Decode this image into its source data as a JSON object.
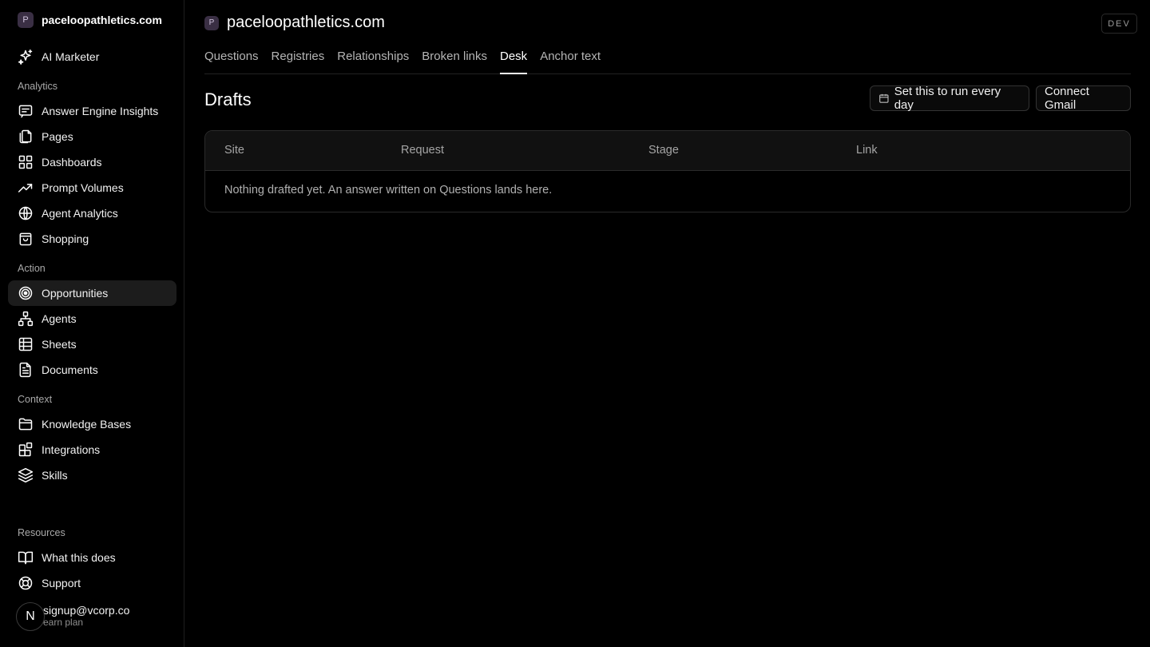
{
  "sidebar": {
    "workspace": {
      "initial": "P",
      "name": "paceloopathletics.com"
    },
    "top_item": {
      "label": "AI Marketer",
      "icon": "sparkles-icon"
    },
    "sections": [
      {
        "title": "Analytics",
        "items": [
          {
            "label": "Answer Engine Insights",
            "icon": "message-square-icon"
          },
          {
            "label": "Pages",
            "icon": "files-icon"
          },
          {
            "label": "Dashboards",
            "icon": "layout-grid-icon"
          },
          {
            "label": "Prompt Volumes",
            "icon": "trending-up-icon"
          },
          {
            "label": "Agent Analytics",
            "icon": "globe-icon"
          },
          {
            "label": "Shopping",
            "icon": "shopping-bag-icon"
          }
        ]
      },
      {
        "title": "Action",
        "items": [
          {
            "label": "Opportunities",
            "icon": "target-icon",
            "active": true
          },
          {
            "label": "Agents",
            "icon": "network-icon"
          },
          {
            "label": "Sheets",
            "icon": "table-icon"
          },
          {
            "label": "Documents",
            "icon": "file-text-icon"
          }
        ]
      },
      {
        "title": "Context",
        "items": [
          {
            "label": "Knowledge Bases",
            "icon": "folder-icon"
          },
          {
            "label": "Integrations",
            "icon": "blocks-icon"
          },
          {
            "label": "Skills",
            "icon": "layers-icon"
          }
        ]
      },
      {
        "title": "Resources",
        "items": [
          {
            "label": "What this does",
            "icon": "book-open-icon"
          },
          {
            "label": "Support",
            "icon": "life-buoy-icon"
          }
        ]
      }
    ],
    "user": {
      "avatar": "N",
      "email": "signup@vcorp.co",
      "plan": "earn plan"
    }
  },
  "header": {
    "initial": "P",
    "title": "paceloopathletics.com",
    "env_badge": "DEV"
  },
  "tabs": [
    {
      "label": "Questions"
    },
    {
      "label": "Registries"
    },
    {
      "label": "Relationships"
    },
    {
      "label": "Broken links"
    },
    {
      "label": "Desk",
      "active": true
    },
    {
      "label": "Anchor text"
    }
  ],
  "main": {
    "title": "Drafts",
    "run_button": "Set this to run every day",
    "gmail_button": "Connect Gmail",
    "table": {
      "columns": [
        "Site",
        "Request",
        "Stage",
        "Link"
      ],
      "empty_message": "Nothing drafted yet. An answer written on Questions lands here."
    }
  },
  "colors": {
    "background": "#000000",
    "active_item": "#1c1c1c",
    "badge": "#3a2f44"
  }
}
